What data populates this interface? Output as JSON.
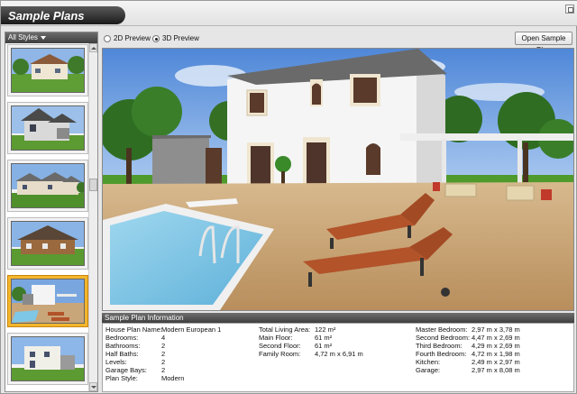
{
  "window": {
    "title": "Sample Plans"
  },
  "sidebar": {
    "styles_dropdown": "All Styles",
    "thumbnails": [
      {
        "name": "plan-thumb-1",
        "selected": false
      },
      {
        "name": "plan-thumb-2",
        "selected": false
      },
      {
        "name": "plan-thumb-3",
        "selected": false
      },
      {
        "name": "plan-thumb-4",
        "selected": false
      },
      {
        "name": "plan-thumb-5",
        "selected": true
      },
      {
        "name": "plan-thumb-6",
        "selected": false
      }
    ]
  },
  "toolbar": {
    "preview_2d": "2D Preview",
    "preview_3d": "3D Preview",
    "selected_mode": "3D Preview",
    "open_button": "Open Sample Plan"
  },
  "info": {
    "header": "Sample Plan Information",
    "col1": [
      {
        "k": "House Plan Name:",
        "v": "Modern European 1"
      },
      {
        "k": "Bedrooms:",
        "v": "4"
      },
      {
        "k": "Bathrooms:",
        "v": "2"
      },
      {
        "k": "Half Baths:",
        "v": "2"
      },
      {
        "k": "Levels:",
        "v": "2"
      },
      {
        "k": "Garage Bays:",
        "v": "2"
      },
      {
        "k": "Plan Style:",
        "v": "Modern"
      }
    ],
    "col2": [
      {
        "k": "Total Living Area:",
        "v": "122 m²"
      },
      {
        "k": "Main Floor:",
        "v": "61 m²"
      },
      {
        "k": "Second Floor:",
        "v": "61 m²"
      },
      {
        "k": "Family Room:",
        "v": "4,72 m x 6,91 m"
      }
    ],
    "col3": [
      {
        "k": "Master Bedroom:",
        "v": "2,97 m x 3,78 m"
      },
      {
        "k": "Second Bedroom:",
        "v": "4,47 m x 2,69 m"
      },
      {
        "k": "Third Bedroom:",
        "v": "4,29 m x 2,69 m"
      },
      {
        "k": "Fourth Bedroom:",
        "v": "4,72 m x 1,98 m"
      },
      {
        "k": "Kitchen:",
        "v": "2,49 m x 2,97 m"
      },
      {
        "k": "Garage:",
        "v": "2,97 m x 8,08 m"
      }
    ]
  },
  "colors": {
    "selection": "#f3b62c",
    "title_bg": "#1a1a1a",
    "sky": "#6f9fe0",
    "grass": "#4f9a2c",
    "pool": "#7ec7e6",
    "deck": "#c9a57a",
    "lounger": "#b2532a"
  },
  "icons": [
    "maximize-icon",
    "dropdown-caret-icon",
    "scroll-up-icon",
    "scroll-down-icon"
  ]
}
